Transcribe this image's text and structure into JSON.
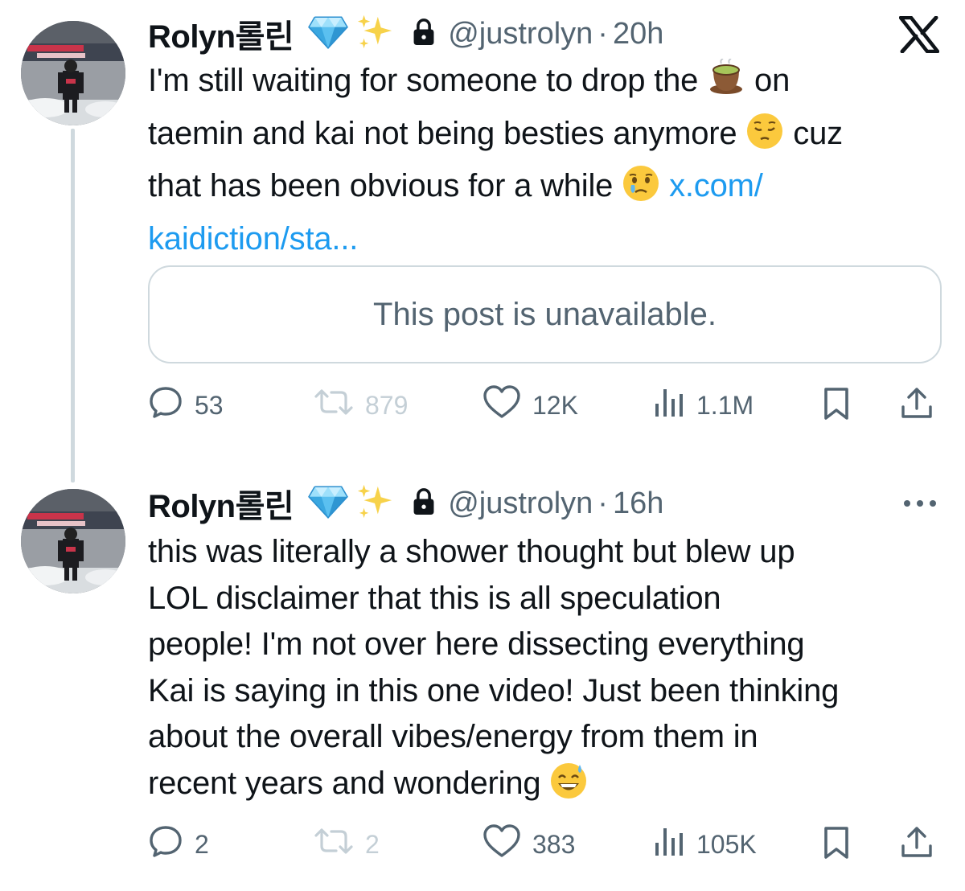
{
  "colors": {
    "text_primary": "#0f1419",
    "text_secondary": "#536471",
    "link": "#1d9bf0",
    "border": "#cfd9de",
    "disabled": "#c4cfd6"
  },
  "tweets": [
    {
      "author": {
        "name": "Rolyn롤린",
        "handle": "@justrolyn",
        "badges": [
          "gem-stone-emoji",
          "sparkles-emoji",
          "lock-icon"
        ]
      },
      "time": "20h",
      "separator": "·",
      "body_lines": [
        {
          "text": "I'm still waiting for someone to drop the",
          "emoji": "teacup-emoji",
          "after": "on"
        },
        {
          "text": "taemin and kai not being besties anymore",
          "emoji": "pensive-face-emoji",
          "after": "cuz"
        },
        {
          "text": "that has been obvious for a while",
          "emoji": "face-holding-back-tears-emoji",
          "link": "x.com/"
        },
        {
          "link": "kaidiction/sta..."
        }
      ],
      "quote": {
        "text": "This post is unavailable."
      },
      "actions": {
        "replies": "53",
        "reposts": "879",
        "likes": "12K",
        "views": "1.1M"
      }
    },
    {
      "author": {
        "name": "Rolyn롤린",
        "handle": "@justrolyn",
        "badges": [
          "gem-stone-emoji",
          "sparkles-emoji",
          "lock-icon"
        ]
      },
      "time": "16h",
      "separator": "·",
      "body_lines": [
        {
          "text": "this was literally a shower thought but blew up"
        },
        {
          "text": "LOL disclaimer that this is all speculation"
        },
        {
          "text": "people! I'm not over here dissecting everything"
        },
        {
          "text": "Kai is saying in this one video! Just been thinking"
        },
        {
          "text": "about the overall vibes/energy from them in"
        },
        {
          "text": "recent years and wondering",
          "emoji": "grinning-face-with-sweat-emoji"
        }
      ],
      "actions": {
        "replies": "2",
        "reposts": "2",
        "likes": "383",
        "views": "105K"
      }
    }
  ]
}
